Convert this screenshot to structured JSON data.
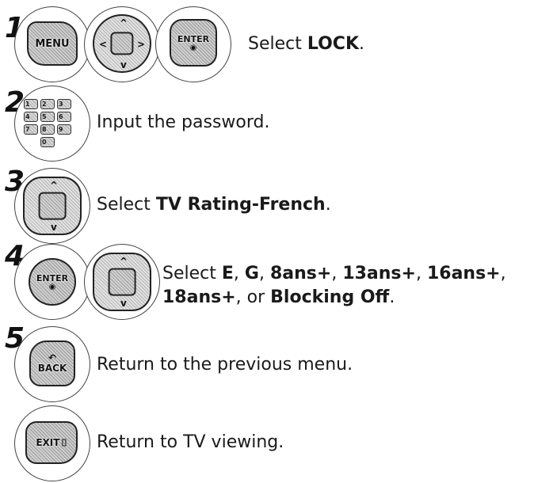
{
  "steps": [
    {
      "number": "1",
      "buttons": {
        "menu": "MENU",
        "enter": "ENTER"
      },
      "text": {
        "prefix": "Select ",
        "bold": "LOCK",
        "suffix": "."
      }
    },
    {
      "number": "2",
      "keypad": [
        "1",
        "2",
        "3",
        "4",
        "5",
        "6",
        "7",
        "8",
        "9",
        "0"
      ],
      "text": {
        "prefix": "Input the password.",
        "bold": "",
        "suffix": ""
      }
    },
    {
      "number": "3",
      "text": {
        "prefix": "Select ",
        "bold": "TV Rating-French",
        "suffix": "."
      }
    },
    {
      "number": "4",
      "buttons": {
        "enter": "ENTER"
      },
      "text": {
        "line1_prefix": "Select ",
        "opt1": "E",
        "sep1": ", ",
        "opt2": "G",
        "sep2": ", ",
        "opt3": "8ans+",
        "sep3": ", ",
        "opt4": "13ans+",
        "sep4": ", ",
        "opt5": "16ans+",
        "sep5": ",",
        "opt6": "18ans+",
        "sep6": ", or ",
        "opt7": "Blocking Off",
        "end": "."
      }
    },
    {
      "number": "5",
      "buttons": {
        "back": "BACK"
      },
      "text": {
        "prefix": "Return to the previous menu.",
        "bold": "",
        "suffix": ""
      }
    },
    {
      "number": "",
      "buttons": {
        "exit": "EXIT"
      },
      "text": {
        "prefix": "Return to TV viewing.",
        "bold": "",
        "suffix": ""
      }
    }
  ],
  "icons": {
    "menu": "menu-button-icon",
    "nav": "navigation-pad-icon",
    "enter": "enter-button-icon",
    "keypad": "number-keypad-icon",
    "back": "back-button-icon",
    "exit": "exit-button-icon"
  }
}
